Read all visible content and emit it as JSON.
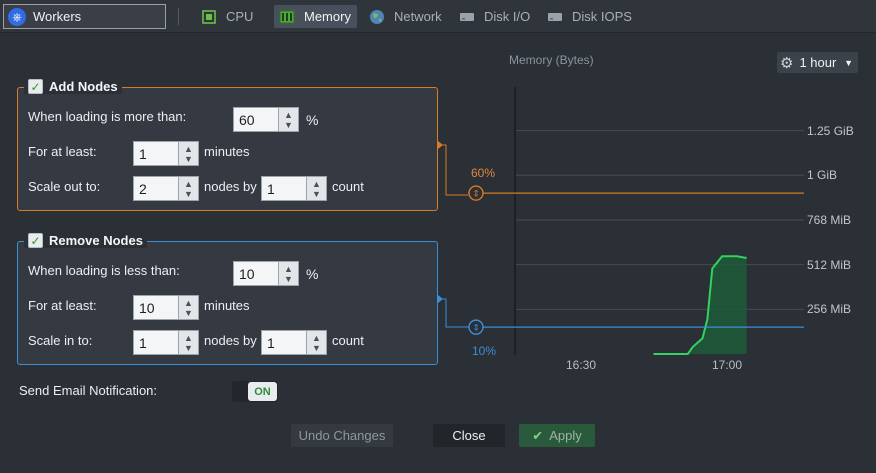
{
  "header": {
    "node_group": "Workers",
    "tabs": [
      {
        "label": "CPU",
        "icon": "cpu-icon"
      },
      {
        "label": "Memory",
        "icon": "memory-icon",
        "active": true
      },
      {
        "label": "Network",
        "icon": "globe-icon"
      },
      {
        "label": "Disk I/O",
        "icon": "disk-icon"
      },
      {
        "label": "Disk IOPS",
        "icon": "disk-icon"
      }
    ]
  },
  "add_nodes": {
    "title": "Add Nodes",
    "checked": true,
    "loading_label": "When loading is more than:",
    "loading_value": "60",
    "percent": "%",
    "for_label": "For at least:",
    "for_value": "1",
    "minutes": "minutes",
    "scale_label": "Scale out to:",
    "scale_value": "2",
    "nodes_by": "nodes by",
    "count_value": "1",
    "count": "count",
    "color": "#d87a27"
  },
  "remove_nodes": {
    "title": "Remove Nodes",
    "checked": true,
    "loading_label": "When loading is less than:",
    "loading_value": "10",
    "percent": "%",
    "for_label": "For at least:",
    "for_value": "10",
    "minutes": "minutes",
    "scale_label": "Scale in to:",
    "scale_value": "1",
    "nodes_by": "nodes by",
    "count_value": "1",
    "count": "count",
    "color": "#3b8fd8"
  },
  "chart": {
    "title": "Memory (Bytes)",
    "period": "1 hour",
    "upper_threshold_label": "60%",
    "lower_threshold_label": "10%"
  },
  "chart_data": {
    "type": "area",
    "title": "Memory (Bytes)",
    "y_ticks": [
      "256 MiB",
      "512 MiB",
      "768 MiB",
      "1 GiB",
      "1.25 GiB"
    ],
    "x_ticks": [
      "16:30",
      "17:00"
    ],
    "series": [
      {
        "values": [
          {
            "x": "16:45",
            "y": 0
          },
          {
            "x": "16:52",
            "y": 0
          },
          {
            "x": "16:53",
            "y": 40
          },
          {
            "x": "16:55",
            "y": 90
          },
          {
            "x": "16:56",
            "y": 200
          },
          {
            "x": "16:57",
            "y": 490
          },
          {
            "x": "16:59",
            "y": 560
          },
          {
            "x": "17:02",
            "y": 560
          },
          {
            "x": "17:04",
            "y": 550
          }
        ]
      }
    ],
    "thresholds": [
      {
        "label": "60%",
        "y_mib": 922
      },
      {
        "label": "10%",
        "y_mib": 154
      }
    ],
    "y_unit": "MiB",
    "grid": true
  },
  "footer": {
    "email_label": "Send Email Notification:",
    "toggle": "ON",
    "undo": "Undo Changes",
    "close": "Close",
    "apply": "Apply"
  }
}
